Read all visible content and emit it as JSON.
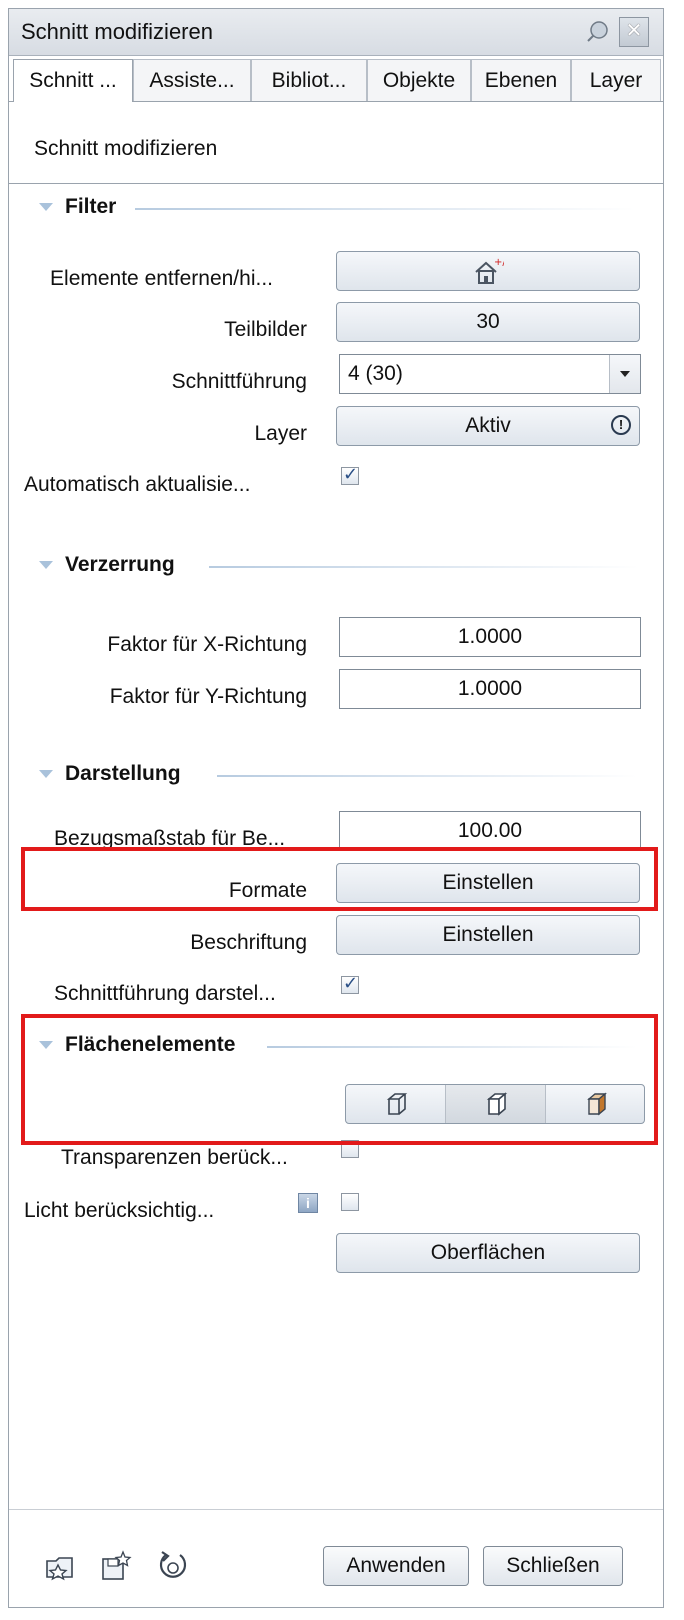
{
  "window": {
    "title": "Schnitt modifizieren"
  },
  "tabs": [
    {
      "label": "Schnitt ..."
    },
    {
      "label": "Assiste..."
    },
    {
      "label": "Bibliot..."
    },
    {
      "label": "Objekte"
    },
    {
      "label": "Ebenen"
    },
    {
      "label": "Layer"
    }
  ],
  "subheader": "Schnitt modifizieren",
  "filter": {
    "title": "Filter",
    "remove_label": "Elemente entfernen/hi...",
    "remove_icon": "house-plus-minus-icon",
    "teilbilder_label": "Teilbilder",
    "teilbilder_value": "30",
    "schnittfuehrung_label": "Schnittführung",
    "schnittfuehrung_value": "4 (30)",
    "layer_label": "Layer",
    "layer_value": "Aktiv",
    "auto_label": "Automatisch aktualisie...",
    "auto_checked": true
  },
  "verzerrung": {
    "title": "Verzerrung",
    "x_label": "Faktor für X-Richtung",
    "x_value": "1.0000",
    "y_label": "Faktor für Y-Richtung",
    "y_value": "1.0000"
  },
  "darstellung": {
    "title": "Darstellung",
    "massstab_label": "Bezugsmaßstab für Be...",
    "massstab_value": "100.00",
    "formate_label": "Formate",
    "formate_button": "Einstellen",
    "beschriftung_label": "Beschriftung",
    "beschriftung_button": "Einstellen",
    "show_label": "Schnittführung darstel...",
    "show_checked": true
  },
  "flaechen": {
    "title": "Flächenelemente",
    "modes": [
      "wireframe-cube-icon",
      "hidden-line-cube-icon",
      "shaded-cube-icon"
    ],
    "selected_mode": 1,
    "transp_label": "Transparenzen berück...",
    "transp_checked": false,
    "licht_label": "Licht berücksichtig...",
    "licht_checked": false,
    "oberflaechen_button": "Oberflächen"
  },
  "footer": {
    "apply_button": "Anwenden",
    "close_button": "Schließen",
    "icons": [
      "open-favorite-icon",
      "save-favorite-icon",
      "reset-icon"
    ]
  },
  "colors": {
    "highlight": "#e21a1a",
    "accent": "#a9c2db"
  }
}
